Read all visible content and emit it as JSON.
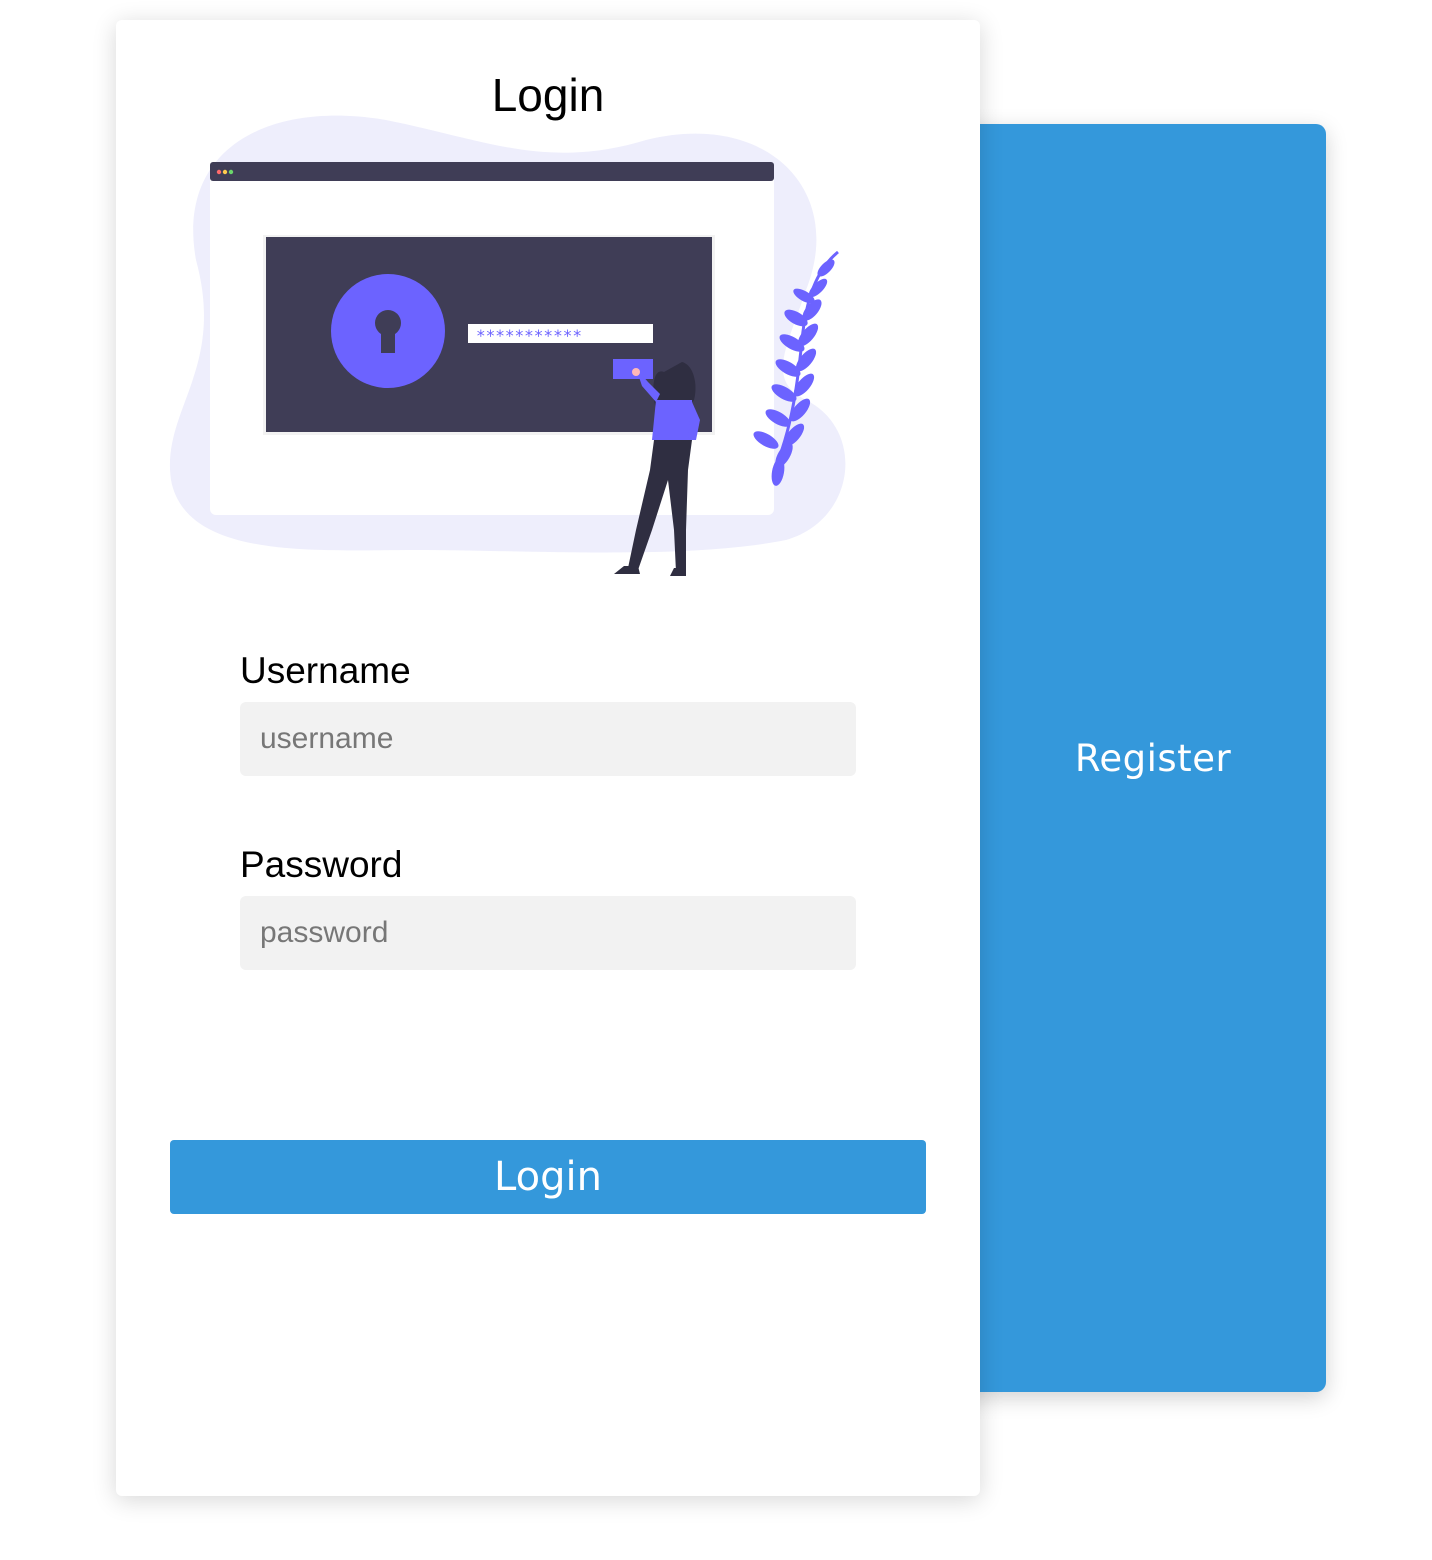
{
  "login": {
    "title": "Login",
    "username": {
      "label": "Username",
      "placeholder": "username",
      "value": ""
    },
    "password": {
      "label": "Password",
      "placeholder": "password",
      "value": ""
    },
    "submit_label": "Login"
  },
  "register": {
    "label": "Register"
  },
  "illustration": {
    "password_mask": "***********",
    "icon": "secure-login-illustration"
  },
  "colors": {
    "accent": "#3498db",
    "input_bg": "#f2f2f2",
    "illustration_purple": "#6c63ff",
    "illustration_dark": "#3f3d56",
    "illustration_blob": "#eeeefc"
  }
}
